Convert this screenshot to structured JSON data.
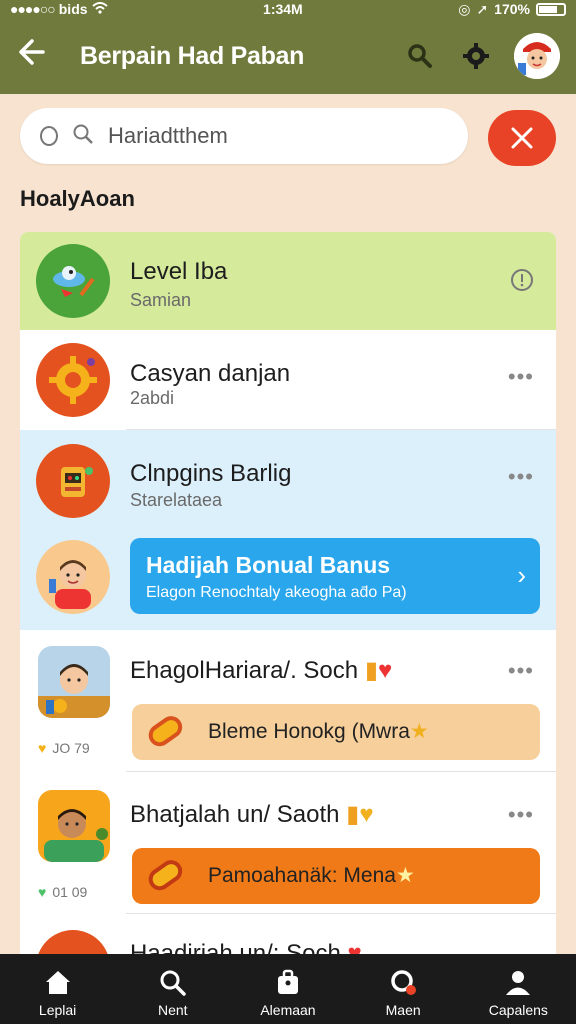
{
  "status": {
    "carrier": "bids",
    "time": "1:34M",
    "battery": "170%"
  },
  "appbar": {
    "title": "Berpain Had Paban"
  },
  "search": {
    "placeholder": "Hariadtthem"
  },
  "section": {
    "label": "HoalyAoan"
  },
  "items": [
    {
      "name": "Level Iba",
      "sub": "Samian"
    },
    {
      "name": "Casyan danjan",
      "sub": "2abdi"
    },
    {
      "name": "Clnpgins Barlig",
      "sub": "Starelataea"
    },
    {
      "name": "EhagolHariara/. Soch",
      "pill": "Bleme Honokg (Mwra",
      "stat": "JO 79"
    },
    {
      "name": "Bhatjalah un/ Saoth",
      "pill": "Pamoahanäk: Mena",
      "stat": "01 09"
    },
    {
      "name": "Haadiriah un/: Soch"
    }
  ],
  "banner": {
    "title": "Hadijah Bonual Banus",
    "subtitle": "Elagon Renochtaly akeogha ad̄o Pa)"
  },
  "nav": [
    {
      "label": "Leplai"
    },
    {
      "label": "Nent"
    },
    {
      "label": "Alemaan"
    },
    {
      "label": "Maen"
    },
    {
      "label": "Capalens"
    }
  ],
  "colors": {
    "appbar": "#6f7a3c",
    "accent": "#e84326",
    "banner": "#2aa6ec",
    "highlight_green": "#d6ea9c",
    "highlight_blue": "#dcf0fb"
  }
}
